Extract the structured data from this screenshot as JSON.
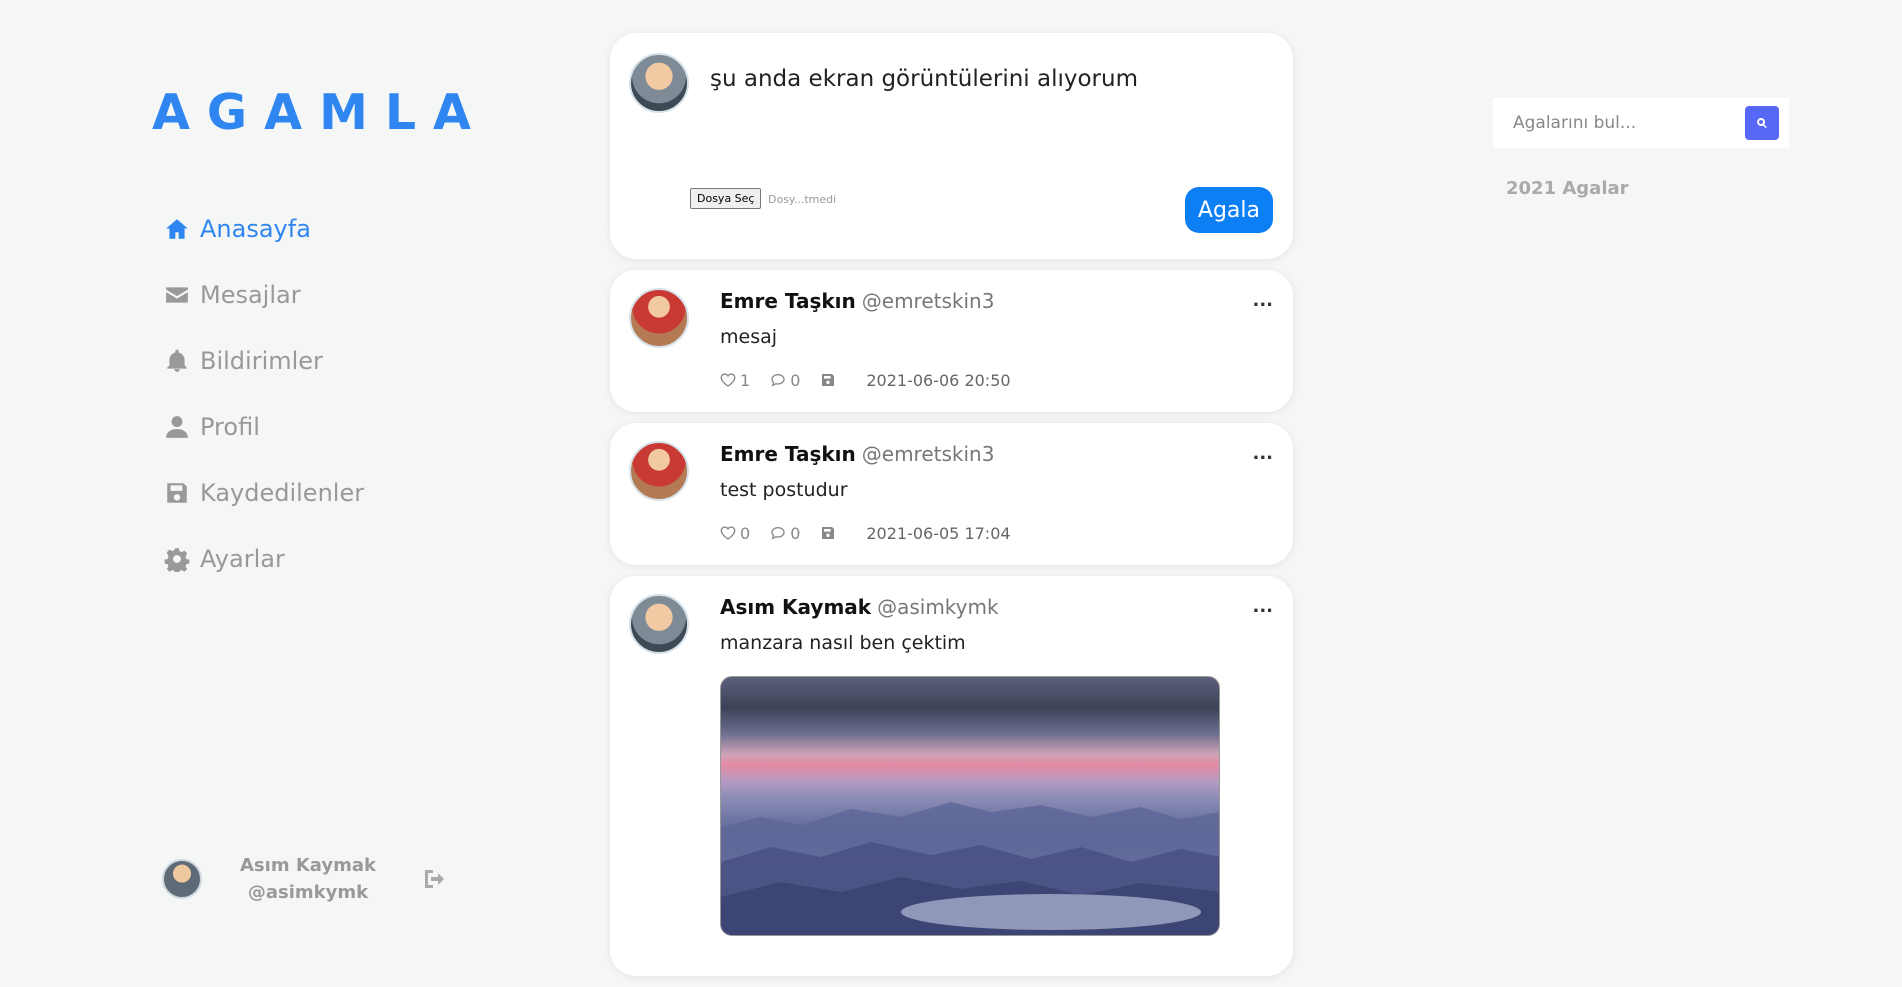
{
  "app": {
    "logo": "AGAMLA"
  },
  "sidebar": {
    "items": [
      {
        "label": "Anasayfa",
        "icon": "home-icon",
        "active": true
      },
      {
        "label": "Mesajlar",
        "icon": "envelope-icon",
        "active": false
      },
      {
        "label": "Bildirimler",
        "icon": "bell-icon",
        "active": false
      },
      {
        "label": "Profil",
        "icon": "user-icon",
        "active": false
      },
      {
        "label": "Kaydedilenler",
        "icon": "save-icon",
        "active": false
      },
      {
        "label": "Ayarlar",
        "icon": "gear-icon",
        "active": false
      }
    ],
    "user": {
      "name": "Asım Kaymak",
      "handle": "@asimkymk"
    }
  },
  "composer": {
    "text": "şu anda ekran görüntülerini alıyorum",
    "file_button": "Dosya Seç",
    "file_status": "Dosy...tmedi",
    "submit_label": "Agala"
  },
  "posts": [
    {
      "name": "Emre Taşkın",
      "handle": "@emretskin3",
      "text": "mesaj",
      "likes": "1",
      "comments": "0",
      "time": "2021-06-06 20:50",
      "more": "..."
    },
    {
      "name": "Emre Taşkın",
      "handle": "@emretskin3",
      "text": "test postudur",
      "likes": "0",
      "comments": "0",
      "time": "2021-06-05 17:04",
      "more": "..."
    },
    {
      "name": "Asım Kaymak",
      "handle": "@asimkymk",
      "text": "manzara nasıl ben çektim",
      "more": "..."
    }
  ],
  "search": {
    "placeholder": "Agalarını bul..."
  },
  "right": {
    "section_title": "2021 Agalar"
  },
  "colors": {
    "accent": "#2f86f0",
    "button": "#0d7ff5",
    "search_button": "#5668f5"
  }
}
